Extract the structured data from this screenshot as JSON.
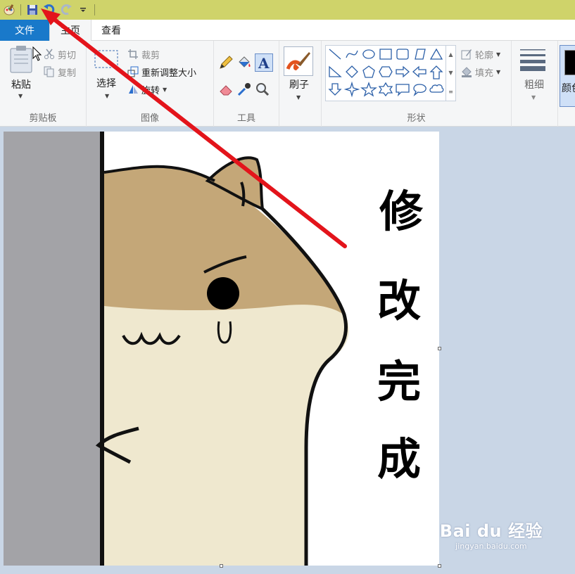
{
  "ribbon_tabs": {
    "file": "文件",
    "home": "主页",
    "view": "查看"
  },
  "clipboard": {
    "paste": "粘贴",
    "cut": "剪切",
    "copy": "复制",
    "label": "剪贴板"
  },
  "image": {
    "select": "选择",
    "crop": "裁剪",
    "resize": "重新调整大小",
    "rotate": "旋转",
    "label": "图像"
  },
  "tools": {
    "label": "工具"
  },
  "brushes": {
    "label": "刷子"
  },
  "shapes": {
    "outline": "轮廓",
    "fill": "填充",
    "label": "形状"
  },
  "size": {
    "label": "粗细"
  },
  "colors": {
    "label": "颜色"
  },
  "canvas": {
    "text_chars": [
      "修",
      "改",
      "完",
      "成"
    ]
  },
  "watermark": {
    "brand": "Bai du 经验",
    "url": "jingyan.baidu.com"
  },
  "colors_hex": {
    "accent": "#1979ca",
    "titlebar": "#cfd36a",
    "arrow": "#e3141b"
  }
}
